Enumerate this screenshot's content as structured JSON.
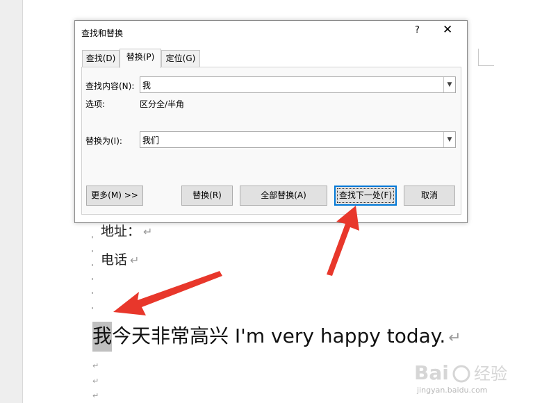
{
  "dialog": {
    "title": "查找和替换",
    "help_label": "?",
    "close_label": "✕",
    "tabs": [
      {
        "label": "查找(D)",
        "active": false
      },
      {
        "label": "替换(P)",
        "active": true
      },
      {
        "label": "定位(G)",
        "active": false
      }
    ],
    "find_label": "查找内容(N):",
    "find_value": "我",
    "options_label": "选项:",
    "options_value": "区分全/半角",
    "replace_label": "替换为(I):",
    "replace_value": "我们",
    "buttons": {
      "more": "更多(M) >>",
      "replace": "替换(R)",
      "replace_all": "全部替换(A)",
      "find_next": "查找下一处(F)",
      "cancel": "取消"
    }
  },
  "document": {
    "address_label": "地址：",
    "phone_label": "电话",
    "highlighted_word": "我",
    "main_text_rest": "今天非常高兴 I'm very happy today.",
    "para_mark": "↵"
  },
  "watermark": {
    "logo": "Bai 经验",
    "url": "jingyan.baidu.com"
  },
  "colors": {
    "highlight": "#c0c0c0",
    "arrow": "#e8372b",
    "focus_border": "#0078d7"
  }
}
